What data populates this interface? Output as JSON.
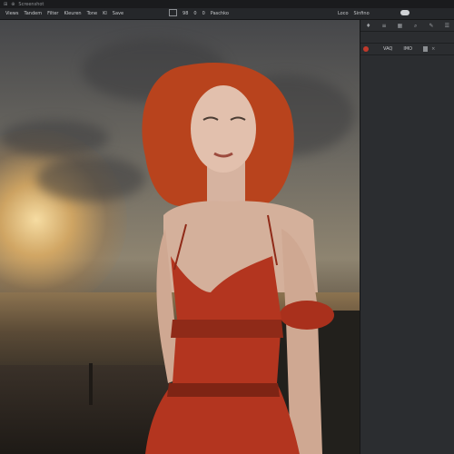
{
  "titlebar": {
    "items": [
      "⊞",
      "⊕",
      "Screenshot"
    ]
  },
  "toolbar": {
    "items": [
      "Views",
      "Tandem",
      "Filter",
      "Kleuren",
      "Tone",
      "Kl",
      "Save"
    ],
    "zoom_value": "98",
    "value_b": "0",
    "value_c": "0",
    "mode_label": "Paschko",
    "right_items": [
      "Loco",
      "Sinfino"
    ]
  },
  "side_panel": {
    "tab_icons": [
      "pin-icon",
      "layers-icon",
      "grid-icon",
      "search-icon",
      "brush-icon",
      "list-icon"
    ],
    "layer": {
      "value_a": "VAQ",
      "value_b": "IMO",
      "close": "×"
    }
  },
  "canvas": {
    "subject": "portrait",
    "accent_colors": {
      "dress": "#b3351f",
      "hair": "#c2461f",
      "sky": "#6b6861",
      "sun": "#f6dca2"
    }
  }
}
